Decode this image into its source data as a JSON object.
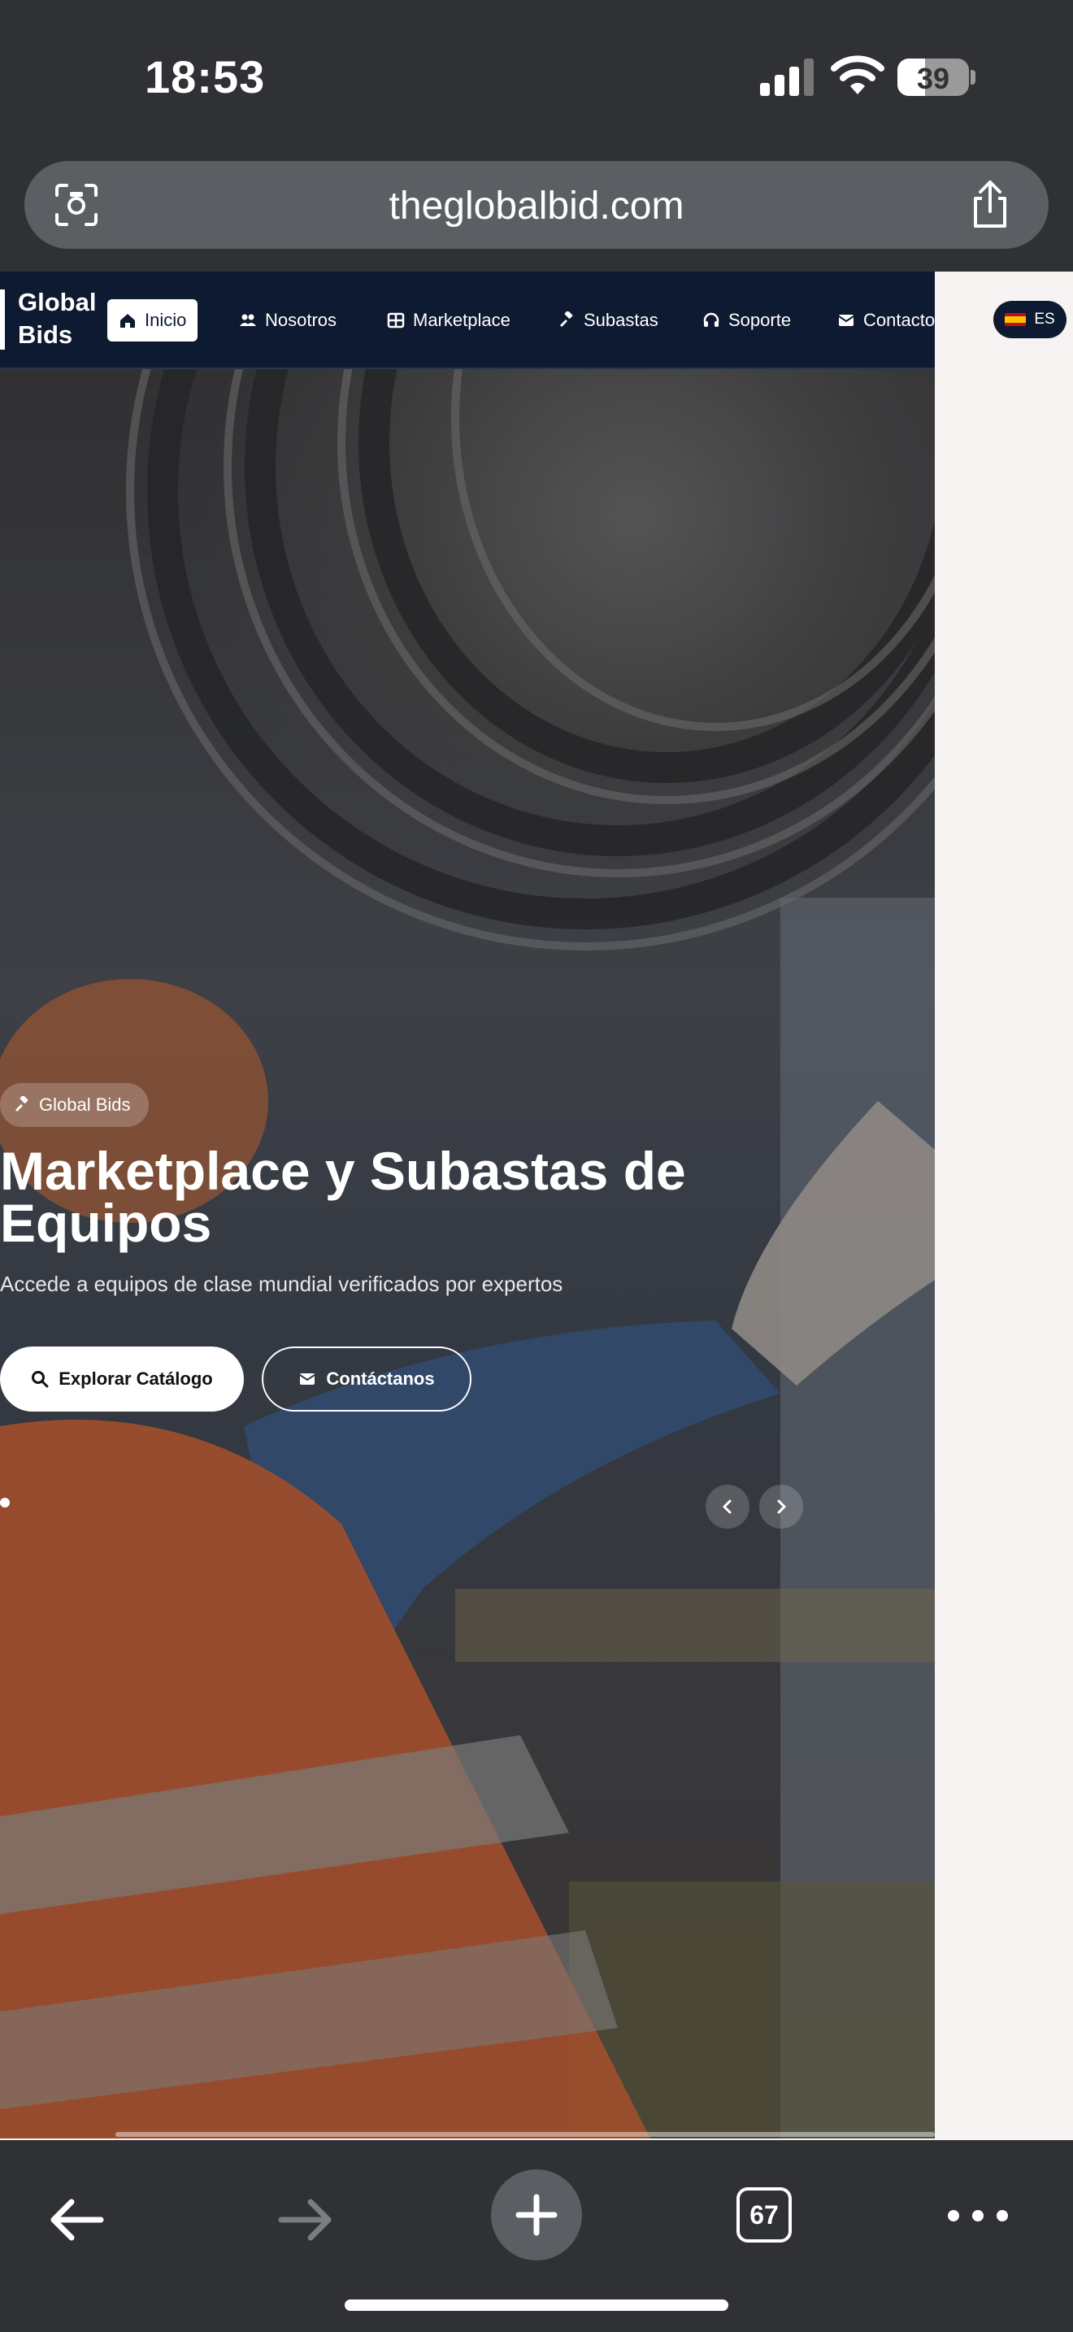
{
  "status_bar": {
    "time": "18:53",
    "battery": "39",
    "battery_level": 0.39
  },
  "browser": {
    "url": "theglobalbid.com",
    "tab_count": "67"
  },
  "site": {
    "logo_line1": "Global",
    "logo_line2": "Bids",
    "nav": [
      {
        "label": "Inicio",
        "icon": "home-icon"
      },
      {
        "label": "Nosotros",
        "icon": "users-icon"
      },
      {
        "label": "Marketplace",
        "icon": "grid-icon"
      },
      {
        "label": "Subastas",
        "icon": "gavel-icon"
      },
      {
        "label": "Soporte",
        "icon": "headset-icon"
      },
      {
        "label": "Contacto",
        "icon": "envelope-icon"
      }
    ],
    "language": "ES"
  },
  "hero": {
    "badge": "Global Bids",
    "title": "Marketplace y Subastas de Equipos",
    "subtitle": "Accede a equipos de clase mundial verificados por expertos",
    "primary_button": "Explorar Catálogo",
    "secondary_button": "Contáctanos"
  }
}
